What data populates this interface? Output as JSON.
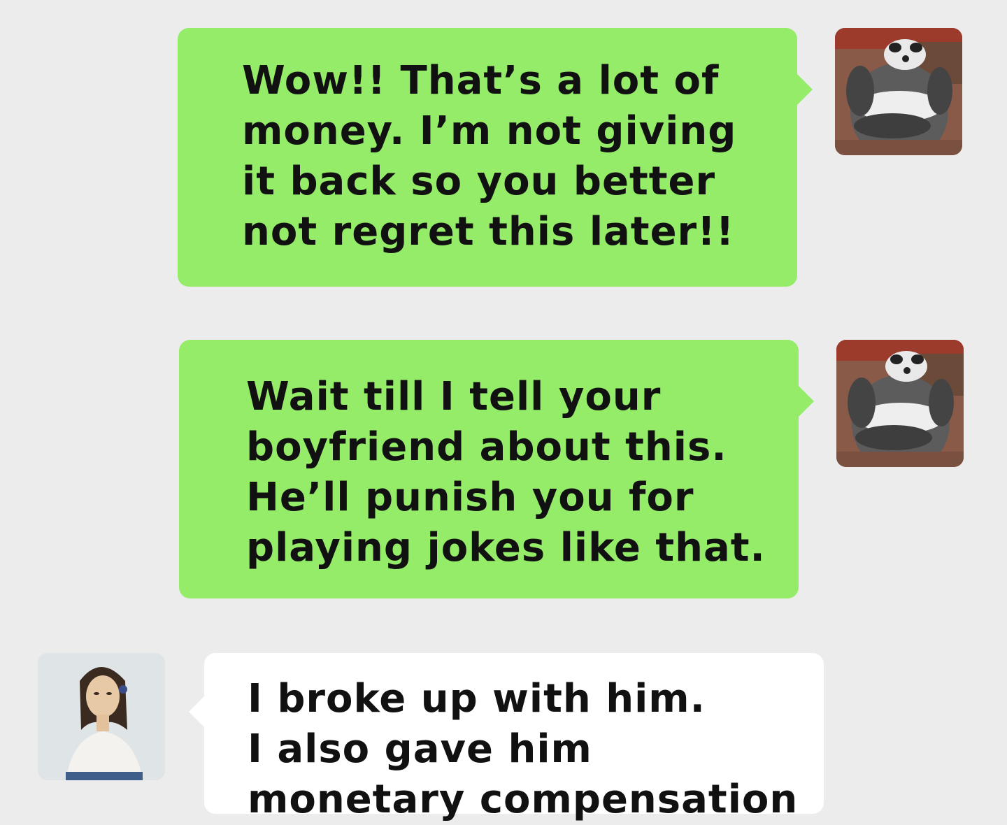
{
  "messages": [
    {
      "side": "outgoing",
      "sender": "panda",
      "text": "Wow!! That’s a lot of\nmoney. I’m not giving\nit back so you better\nnot regret this later!!"
    },
    {
      "side": "outgoing",
      "sender": "panda",
      "text": "Wait till I tell your\nboyfriend about this.\nHe’ll punish you for\nplaying jokes like that."
    },
    {
      "side": "incoming",
      "sender": "woman",
      "text": "I broke up with him.\nI also gave him\nmonetary compensation"
    }
  ],
  "avatars": {
    "panda": "panda-avatar",
    "woman": "woman-portrait-avatar"
  },
  "colors": {
    "background": "#ececec",
    "outgoing_bubble": "#95ec69",
    "incoming_bubble": "#ffffff",
    "text": "#111111"
  }
}
